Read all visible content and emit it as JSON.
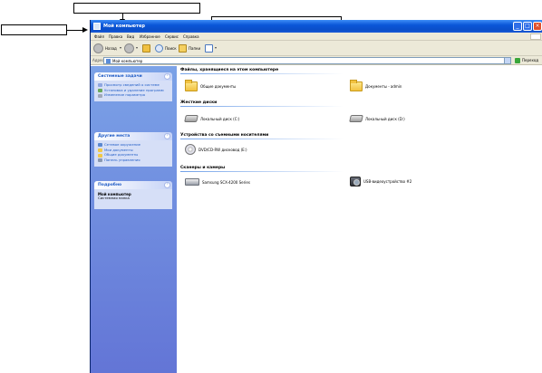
{
  "window": {
    "title": "Мой компьютер"
  },
  "menubar": {
    "items": [
      "Файл",
      "Правка",
      "Вид",
      "Избранное",
      "Сервис",
      "Справка"
    ]
  },
  "toolbar": {
    "back_label": "Назад",
    "search_label": "Поиск",
    "folders_label": "Папки"
  },
  "addressbar": {
    "label": "Адрес:",
    "value": "Мой компьютер",
    "go_label": "Переход"
  },
  "taskpane": {
    "system_tasks": {
      "title": "Системные задачи",
      "links": [
        "Просмотр сведений о системе",
        "Установка и удаление программ",
        "Изменение параметра"
      ]
    },
    "other_places": {
      "title": "Другие места",
      "links": [
        "Сетевое окружение",
        "Мои документы",
        "Общие документы",
        "Панель управления"
      ]
    },
    "details": {
      "title": "Подробно",
      "name": "Мой компьютер",
      "subtitle": "Системная папка"
    }
  },
  "content": {
    "groups": [
      {
        "title": "Файлы, хранящиеся на этом компьютере",
        "items": [
          "Общие документы",
          "Документы - admin"
        ]
      },
      {
        "title": "Жесткие диски",
        "items": [
          "Локальный диск (C:)",
          "Локальный диск (D:)"
        ]
      },
      {
        "title": "Устройства со съемными носителями",
        "items": [
          "DVD/CD-RW дисковод (E:)"
        ]
      },
      {
        "title": "Сканеры и камеры",
        "items": [
          "Samsung SCX-4200 Series",
          "USB-видеоустройство #2"
        ]
      }
    ]
  },
  "icons": {
    "window": "computer-icon",
    "back": "back-arrow-icon",
    "forward": "forward-arrow-icon",
    "up": "folder-up-icon",
    "search": "search-icon",
    "folders": "folders-icon",
    "views": "views-icon",
    "go": "go-arrow-icon"
  },
  "colors": {
    "titlebar": "#0a56d8",
    "taskpane": "#6f8fe0",
    "panel_link": "#215dc6",
    "close_button": "#e0502c"
  }
}
